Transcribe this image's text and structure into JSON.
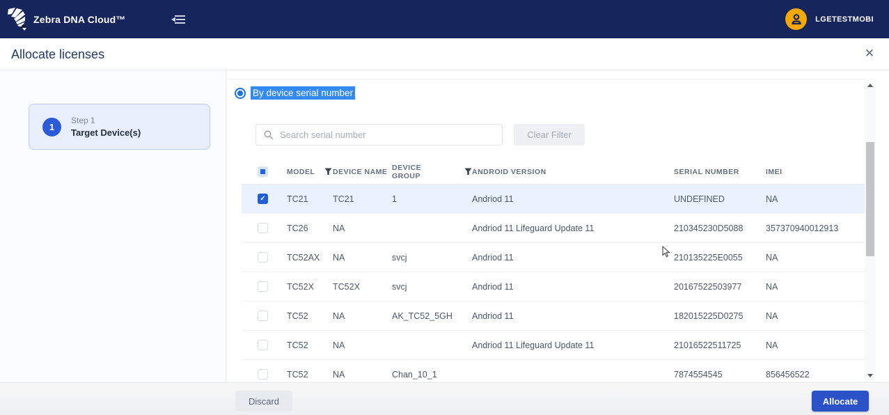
{
  "navbar": {
    "brand": "Zebra DNA Cloud™",
    "user": "LGETESTMOBI"
  },
  "modal": {
    "title": "Allocate licenses",
    "close_glyph": "✕"
  },
  "step": {
    "number": "1",
    "label": "Step 1",
    "title": "Target Device(s)"
  },
  "filter": {
    "radio_label": "By device serial number",
    "radio_selected": true,
    "search_placeholder": "Search serial number",
    "search_value": "",
    "clear_button": "Clear Filter"
  },
  "table": {
    "columns": [
      "MODEL",
      "DEVICE NAME",
      "DEVICE GROUP",
      "ANDROID VERSION",
      "SERIAL NUMBER",
      "IMEI"
    ],
    "header_checkbox_state": "indeterminate",
    "rows": [
      {
        "checked": true,
        "selected": true,
        "cells": [
          "TC21",
          "TC21",
          "1",
          "Andriod 11",
          "UNDEFINED",
          "NA"
        ]
      },
      {
        "checked": false,
        "selected": false,
        "cells": [
          "TC26",
          "NA",
          "",
          "Andriod 11 Lifeguard Update 11",
          "210345230D5088",
          "357370940012913"
        ]
      },
      {
        "checked": false,
        "selected": false,
        "cells": [
          "TC52AX",
          "NA",
          "svcj",
          "Andriod 11",
          "210135225E0055",
          "NA"
        ]
      },
      {
        "checked": false,
        "selected": false,
        "cells": [
          "TC52X",
          "TC52X",
          "svcj",
          "Andriod 11",
          "20167522503977",
          "NA"
        ]
      },
      {
        "checked": false,
        "selected": false,
        "cells": [
          "TC52",
          "NA",
          "AK_TC52_5GH",
          "Andriod 11",
          "182015225D0275",
          "NA"
        ]
      },
      {
        "checked": false,
        "selected": false,
        "cells": [
          "TC52",
          "NA",
          "",
          "Andriod 11 Lifeguard Update 11",
          "21016522511725",
          "NA"
        ]
      },
      {
        "checked": false,
        "selected": false,
        "cells": [
          "TC52",
          "NA",
          "Chan_10_1",
          "",
          "7874554545",
          "856456522"
        ]
      }
    ]
  },
  "footer": {
    "discard": "Discard",
    "allocate": "Allocate"
  },
  "colors": {
    "navbar_navy": "#16255b",
    "accent_blue": "#2b52c8",
    "selection_blue": "#338af3",
    "avatar_amber": "#f5a800",
    "selected_row": "#eaf2fd"
  }
}
